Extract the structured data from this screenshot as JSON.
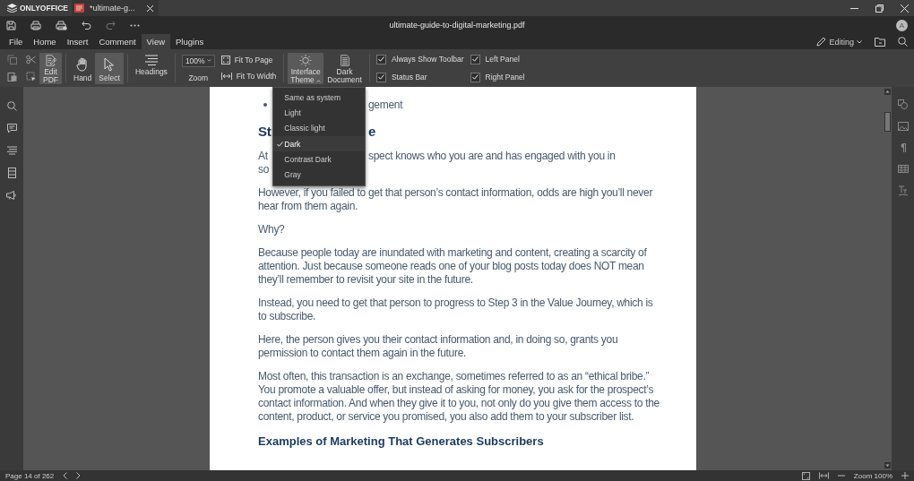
{
  "app": {
    "logo": "ONLYOFFICE",
    "doc_tab": "*ultimate-g..."
  },
  "window_title": "ultimate-guide-to-digital-marketing.pdf",
  "avatar": "A",
  "menu_tabs": [
    {
      "label": "File",
      "selected": false
    },
    {
      "label": "Home",
      "selected": false
    },
    {
      "label": "Insert",
      "selected": false
    },
    {
      "label": "Comment",
      "selected": false
    },
    {
      "label": "View",
      "selected": true
    },
    {
      "label": "Plugins",
      "selected": false
    }
  ],
  "editing": "Editing",
  "toolbar": {
    "edit_pdf": {
      "lines": [
        "Edit",
        "PDF"
      ],
      "pressed": true
    },
    "tools": [
      {
        "label": "Hand",
        "selected": false
      },
      {
        "label": "Select",
        "selected": true
      }
    ],
    "headings": "Headings",
    "zoom_value": "100%",
    "zoom_label": "Zoom",
    "fit_page": "Fit To Page",
    "fit_width": "Fit To Width",
    "interface_theme": {
      "lines": [
        "Interface",
        "Theme"
      ],
      "expanded": true
    },
    "dark_document": [
      "Dark",
      "Document"
    ]
  },
  "checkboxes": [
    {
      "label": "Always Show Toolbar",
      "checked": true
    },
    {
      "label": "Status Bar",
      "checked": true
    },
    {
      "label": "Left Panel",
      "checked": true
    },
    {
      "label": "Right Panel",
      "checked": true
    }
  ],
  "theme_menu": [
    {
      "label": "Same as system",
      "selected": false
    },
    {
      "label": "Light",
      "selected": false
    },
    {
      "label": "Classic light",
      "selected": false
    },
    {
      "label": "Dark",
      "selected": true
    },
    {
      "label": "Contrast Dark",
      "selected": false
    },
    {
      "label": "Gray",
      "selected": false
    }
  ],
  "document": {
    "fragments": [
      {
        "kind": "bullet",
        "after": "gement"
      },
      {
        "kind": "heading",
        "before": "St",
        "after": "e"
      },
      {
        "kind": "text",
        "before": "At",
        "after": "spect knows who you are and has engaged with you in"
      },
      {
        "kind": "text",
        "before": "so"
      }
    ],
    "paragraphs": [
      {
        "kind": "text",
        "text": "However, if you failed to get that person’s contact information, odds are high you’ll never hear from them again."
      },
      {
        "kind": "text",
        "text": "Why?"
      },
      {
        "kind": "text",
        "text": "Because people today are inundated with marketing and content, creating a scarcity of attention. Just because someone reads one of your blog posts today does NOT mean they’ll remember to revisit your site in the future."
      },
      {
        "kind": "text",
        "text": "Instead, you need to get that person to progress to Step 3 in the Value Journey, which is to subscribe."
      },
      {
        "kind": "text",
        "text": "Here, the person gives you their contact information and, in doing so, grants you permission to contact them again in the future."
      },
      {
        "kind": "text",
        "text": "Most often, this transaction is an exchange, sometimes referred to as an “ethical bribe.” You promote a valuable offer, but instead of asking for money, you ask for the prospect’s contact information. And when they give it to you, not only do you give them access to the content, product, or service you promised, you also add them to your subscriber list."
      },
      {
        "kind": "heading",
        "text": "Examples of Marketing That Generates Subscribers"
      }
    ]
  },
  "status_bar": {
    "page": "Page 14 of 262",
    "zoom": "Zoom 100%"
  }
}
